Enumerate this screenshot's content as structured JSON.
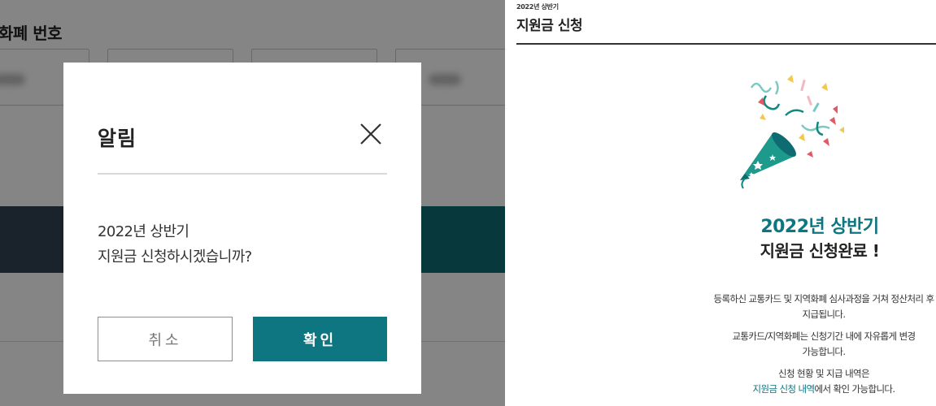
{
  "background_page": {
    "section_title": "화폐 번호"
  },
  "modal": {
    "title": "알림",
    "message_line1": "2022년 상반기",
    "message_line2": "지원금 신청하시겠습니까?",
    "cancel_label": "취소",
    "confirm_label": "확인"
  },
  "completion_page": {
    "header_subtitle": "2022년 상반기",
    "header_title": "지원금 신청",
    "headline_line1": "2022년 상반기",
    "headline_line2": "지원금 신청완료 !",
    "info": [
      {
        "line1": "등록하신 교통카드 및 지역화폐 심사과정을 거쳐 정산처리 후",
        "line2": "지급됩니다."
      },
      {
        "line1": "교통카드/지역화폐는 신청기간 내에 자유롭게 변경",
        "line2": "가능합니다."
      }
    ],
    "info3_line1": "신청 현황 및 지급 내역은",
    "info3_link": "지원금 신청 내역",
    "info3_suffix": "에서 확인 가능합니다."
  },
  "colors": {
    "accent": "#0e7681",
    "overlay": "#000000",
    "bar_left": "#334155",
    "bar_right": "#0e6b72"
  },
  "icons": {
    "close": "close-icon",
    "party": "party-popper-icon"
  }
}
